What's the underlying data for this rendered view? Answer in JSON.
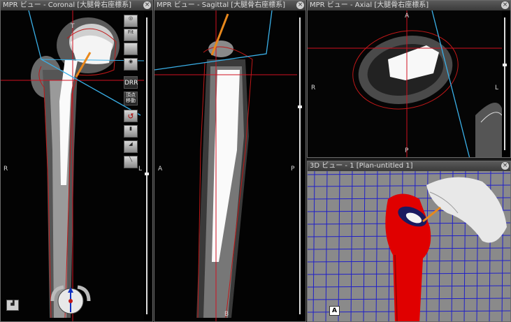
{
  "panes": {
    "coronal": {
      "title": "MPR ビュー - Coronal [大腿骨右座標系]",
      "labels": {
        "top": "T",
        "left": "R",
        "right": "L"
      }
    },
    "sagittal": {
      "title": "MPR ビュー - Sagittal [大腿骨右座標系]",
      "labels": {
        "left": "A",
        "right": "P",
        "bottom": "B"
      }
    },
    "axial": {
      "title": "MPR ビュー - Axial [大腿骨右座標系]",
      "labels": {
        "top": "A",
        "left": "R",
        "right": "L",
        "bottom": "P"
      }
    },
    "view3d": {
      "title": "3D ビュー - 1 [Plan-untitled 1]",
      "orient_cube": "A"
    }
  },
  "toolbar": {
    "fit": "Fit",
    "dr": "DRR",
    "move_label_1": "頂点",
    "move_label_2": "移動"
  },
  "icons": [
    "globe-icon",
    "fit-button",
    "blank-button",
    "eye-icon",
    "drr-button",
    "vertex-move-button",
    "undo-icon",
    "ruler-icon",
    "contrast-icon",
    "pen-icon",
    "histogram-icon",
    "navigation-ring-icon"
  ],
  "colors": {
    "crosshair": "#d01020",
    "plane": "#3ab0e8",
    "implant": "#e8881c",
    "contour": "#c01818",
    "bone3d": "#e00000",
    "grid": "#2020c8"
  }
}
